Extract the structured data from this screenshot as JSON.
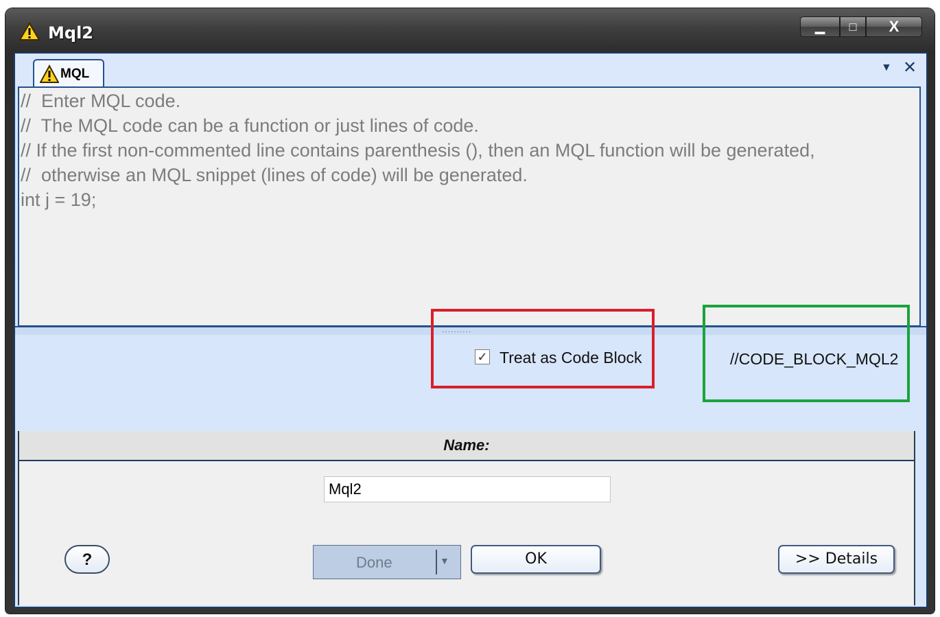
{
  "window": {
    "title": "Mql2",
    "minimize": "▁",
    "maximize": "□",
    "close": "X"
  },
  "tab": {
    "label": "MQL",
    "icon": "warning-icon",
    "menu_glyph": "▼",
    "close_glyph": "✕"
  },
  "editor": {
    "lines": [
      "//  Enter MQL code.",
      "//  The MQL code can be a function or just lines of code.",
      "// If the first non-commented line contains parenthesis (), then an MQL function will be generated,",
      "//  otherwise an MQL snippet (lines of code) will be generated.",
      "int j = 19;"
    ]
  },
  "options": {
    "treat_as_code_block_label": "Treat as Code Block",
    "treat_as_code_block_checked": true,
    "code_block_name": "//CODE_BLOCK_MQL2",
    "highlight_colors": {
      "checkbox_box": "#d91f2b",
      "code_block_box": "#1aa33b"
    }
  },
  "name_section": {
    "label": "Name:",
    "value": "Mql2"
  },
  "buttons": {
    "help": "?",
    "done": "Done",
    "ok": "OK",
    "details": ">> Details"
  }
}
